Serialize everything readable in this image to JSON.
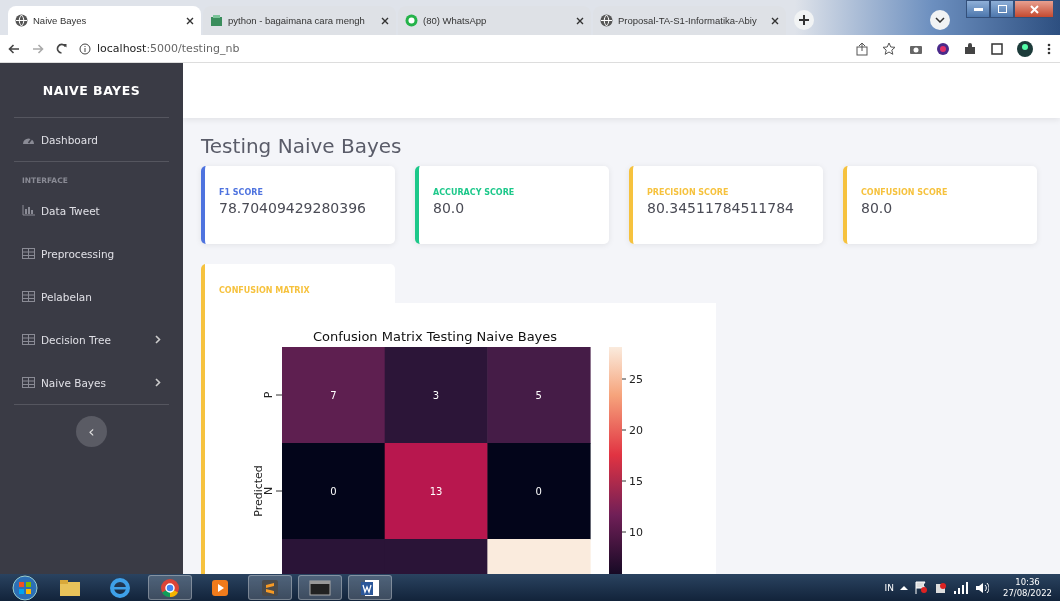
{
  "browser": {
    "tabs": [
      {
        "title": "Naive Bayes",
        "selected": true,
        "kind": "globe"
      },
      {
        "title": "python - bagaimana cara mengh",
        "selected": false,
        "kind": "app"
      },
      {
        "title": "(80) WhatsApp",
        "selected": false,
        "kind": "chat"
      },
      {
        "title": "Proposal-TA-S1-Informatika-Abiy",
        "selected": false,
        "kind": "globe"
      }
    ],
    "address": {
      "host": "localhost",
      "rest": ":5000/testing_nb"
    }
  },
  "sidebar": {
    "brand": "NAIVE BAYES",
    "items": [
      {
        "kind": "gauge",
        "label": "Dashboard",
        "expandable": false
      },
      {
        "kind": "heading",
        "label": "INTERFACE"
      },
      {
        "kind": "chart",
        "label": "Data Tweet",
        "expandable": false
      },
      {
        "kind": "table",
        "label": "Preprocessing",
        "expandable": false
      },
      {
        "kind": "table",
        "label": "Pelabelan",
        "expandable": false
      },
      {
        "kind": "table",
        "label": "Decision Tree",
        "expandable": true
      },
      {
        "kind": "table",
        "label": "Naive Bayes",
        "expandable": true
      }
    ],
    "toggle": "‹"
  },
  "page": {
    "title": "Testing Naive Bayes",
    "cards": [
      {
        "label": "F1 SCORE",
        "value": "78.70409429280396",
        "color": "#4e73df"
      },
      {
        "label": "ACCURACY SCORE",
        "value": "80.0",
        "color": "#1cc88a"
      },
      {
        "label": "PRECISION SCORE",
        "value": "80.34511784511784",
        "color": "#f6c23e"
      },
      {
        "label": "CONFUSION SCORE",
        "value": "80.0",
        "color": "#f6c23e"
      }
    ],
    "matrix_card": {
      "label": "CONFUSION MATRIX",
      "color": "#f6c23e",
      "heatmap": {
        "title": "Confusion Matrix Testing Naive Bayes",
        "ylabel": "Predicted",
        "rows": [
          {
            "label": "P",
            "cells": [
              {
                "value": "7",
                "color": "#5e1f50"
              },
              {
                "value": "3",
                "color": "#2c1538"
              },
              {
                "value": "5",
                "color": "#451c47"
              }
            ]
          },
          {
            "label": "N",
            "cells": [
              {
                "value": "0",
                "color": "#03051a"
              },
              {
                "value": "13",
                "color": "#b8174e"
              },
              {
                "value": "0",
                "color": "#03051a"
              }
            ]
          },
          {
            "cells": [
              {
                "color": "#2a1437"
              },
              {
                "color": "#2a1437"
              },
              {
                "color": "#faebdd"
              }
            ]
          }
        ],
        "colorbar_ticks": [
          "25",
          "20",
          "15",
          "10"
        ]
      }
    }
  },
  "taskbar": {
    "language": "IN",
    "time": "10:36",
    "date": "27/08/2022"
  }
}
